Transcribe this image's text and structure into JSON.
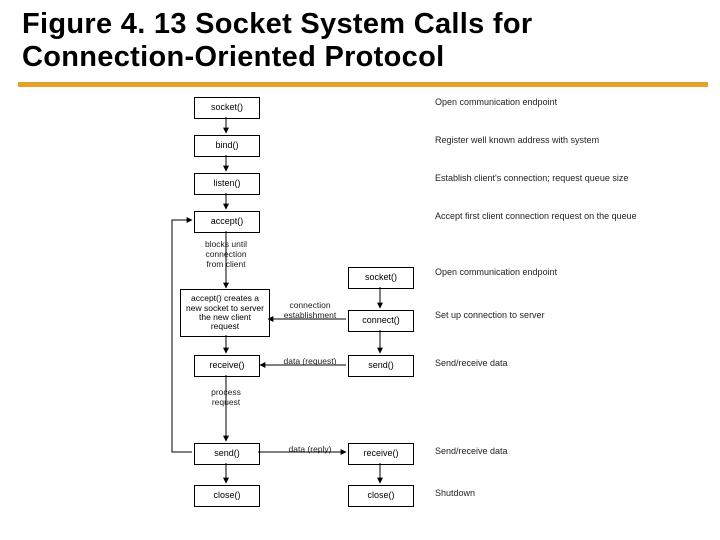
{
  "title": "Figure 4. 13 Socket System Calls for Connection-Oriented Protocol",
  "server": {
    "socket": "socket()",
    "bind": "bind()",
    "listen": "listen()",
    "accept": "accept()",
    "receive": "receive()",
    "send": "send()",
    "close": "close()"
  },
  "client": {
    "socket": "socket()",
    "connect": "connect()",
    "send": "send()",
    "receive": "receive()",
    "close": "close()"
  },
  "notes": {
    "blocks": "blocks until\nconnection\nfrom client",
    "newSocket": "accept() creates\na new socket to\nserver the new\nclient request",
    "process": "process\nrequest"
  },
  "labels": {
    "estab": "connection\nestablishment",
    "req": "data (request)",
    "reply": "data (reply)"
  },
  "desc": {
    "d1": "Open communication\nendpoint",
    "d2": "Register well known\naddress with system",
    "d3": "Establish client's connection;\nrequest queue size",
    "d4": "Accept first client connection\nrequest on the queue",
    "d5": "Open communication\nendpoint",
    "d6": "Set up connection\nto server",
    "d7": "Send/receive data",
    "d8": "Send/receive data",
    "d9": "Shutdown"
  }
}
